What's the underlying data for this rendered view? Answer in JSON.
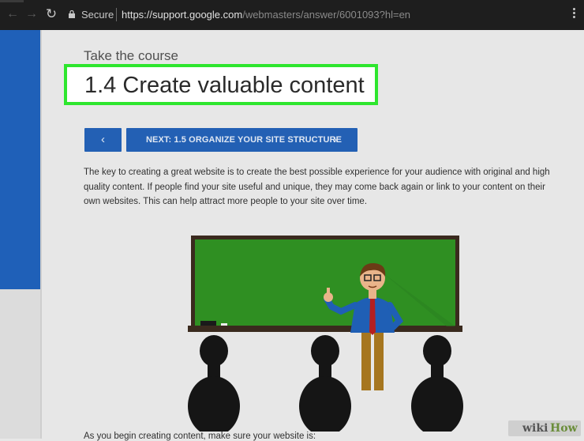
{
  "browser": {
    "secure_label": "Secure",
    "url_host": "https://support.google.com",
    "url_path": "/webmasters/answer/6001093?hl=en"
  },
  "page": {
    "kicker": "Take the course",
    "title": "1.4 Create valuable content",
    "prev_button": "‹",
    "next_button": "NEXT: 1.5 ORGANIZE YOUR SITE STRUCTURE",
    "next_chevron": "›",
    "paragraph": "The key to creating a great website is to create the best possible experience for your audience with original and high quality content. If people find your site useful and unique, they may come back again or link to your content on their own websites. This can help attract more people to your site over time.",
    "bottom_text": "As you begin creating content, make sure your website is:"
  },
  "watermark": {
    "wiki": "wiki",
    "how": "How"
  },
  "colors": {
    "accent_blue": "#2360b4",
    "highlight_green": "#2ee62e",
    "chalkboard": "#2f8f22"
  },
  "icons": [
    "back-arrow-icon",
    "forward-arrow-icon",
    "reload-icon",
    "lock-icon",
    "menu-dots-icon",
    "chevron-left-icon",
    "chevron-right-icon"
  ]
}
